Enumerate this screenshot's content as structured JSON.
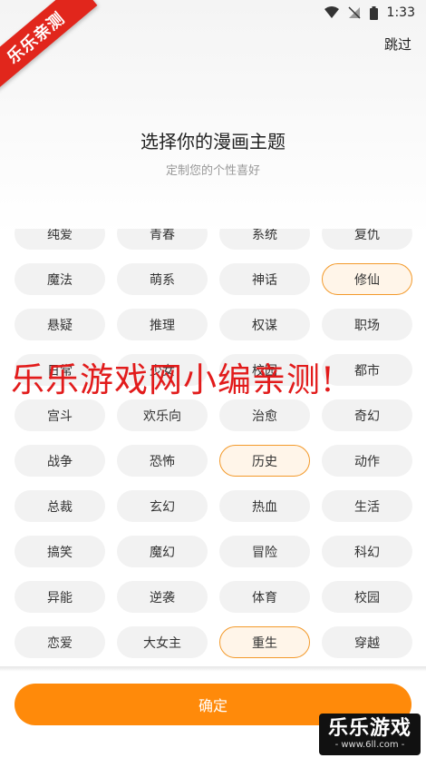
{
  "status_bar": {
    "time": "1:33"
  },
  "corner_badge": "乐乐亲测",
  "header": {
    "skip_label": "跳过"
  },
  "title": "选择你的漫画主题",
  "subtitle": "定制您的个性喜好",
  "tags": [
    {
      "label": "纯爱",
      "selected": false
    },
    {
      "label": "青春",
      "selected": false
    },
    {
      "label": "系统",
      "selected": false
    },
    {
      "label": "复仇",
      "selected": false
    },
    {
      "label": "魔法",
      "selected": false
    },
    {
      "label": "萌系",
      "selected": false
    },
    {
      "label": "神话",
      "selected": false
    },
    {
      "label": "修仙",
      "selected": true
    },
    {
      "label": "悬疑",
      "selected": false
    },
    {
      "label": "推理",
      "selected": false
    },
    {
      "label": "权谋",
      "selected": false
    },
    {
      "label": "职场",
      "selected": false
    },
    {
      "label": "日常",
      "selected": false
    },
    {
      "label": "少女",
      "selected": false
    },
    {
      "label": "校园",
      "selected": false
    },
    {
      "label": "都市",
      "selected": false
    },
    {
      "label": "宫斗",
      "selected": false
    },
    {
      "label": "欢乐向",
      "selected": false
    },
    {
      "label": "治愈",
      "selected": false
    },
    {
      "label": "奇幻",
      "selected": false
    },
    {
      "label": "战争",
      "selected": false
    },
    {
      "label": "恐怖",
      "selected": false
    },
    {
      "label": "历史",
      "selected": true
    },
    {
      "label": "动作",
      "selected": false
    },
    {
      "label": "总裁",
      "selected": false
    },
    {
      "label": "玄幻",
      "selected": false
    },
    {
      "label": "热血",
      "selected": false
    },
    {
      "label": "生活",
      "selected": false
    },
    {
      "label": "搞笑",
      "selected": false
    },
    {
      "label": "魔幻",
      "selected": false
    },
    {
      "label": "冒险",
      "selected": false
    },
    {
      "label": "科幻",
      "selected": false
    },
    {
      "label": "异能",
      "selected": false
    },
    {
      "label": "逆袭",
      "selected": false
    },
    {
      "label": "体育",
      "selected": false
    },
    {
      "label": "校园",
      "selected": false
    },
    {
      "label": "恋爱",
      "selected": false
    },
    {
      "label": "大女主",
      "selected": false
    },
    {
      "label": "重生",
      "selected": true
    },
    {
      "label": "穿越",
      "selected": false
    }
  ],
  "watermark_text": "乐乐游戏网小编亲测!",
  "confirm_label": "确定",
  "logo": {
    "main": "乐乐游戏",
    "sub": "- www.6ll.com -"
  },
  "colors": {
    "accent": "#ff8a0a",
    "selected_border": "#f39a2b",
    "watermark": "#e21b1b"
  }
}
